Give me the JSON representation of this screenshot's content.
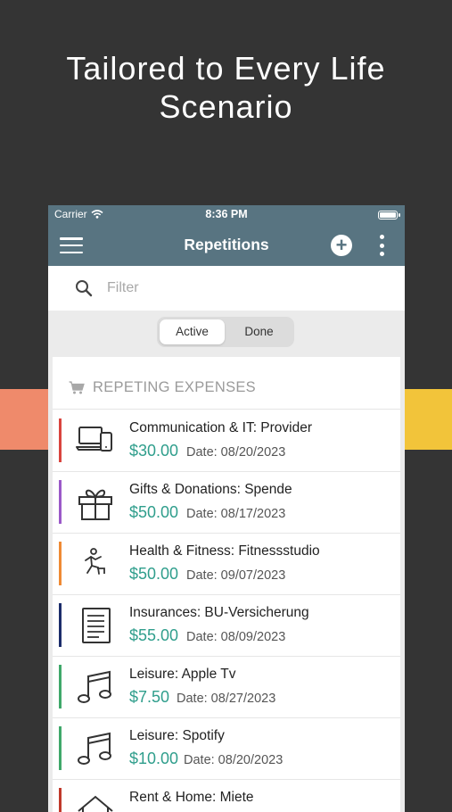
{
  "headline": {
    "line1": "Tailored to Every Life",
    "line2": "Scenario"
  },
  "status": {
    "carrier": "Carrier",
    "time": "8:36 PM"
  },
  "appbar": {
    "title": "Repetitions",
    "add_icon": "plus-circle-icon",
    "more_icon": "more-vertical-icon",
    "menu_icon": "hamburger-icon"
  },
  "search": {
    "placeholder": "Filter",
    "value": ""
  },
  "segments": {
    "active": "Active",
    "done": "Done",
    "selected": "Active"
  },
  "section": {
    "label": "REPETING EXPENSES",
    "icon": "cart-icon"
  },
  "colors": {
    "header": "#587481",
    "amount": "#2f9e8c",
    "left_band": "#ef8a6b",
    "right_band": "#f2c43a"
  },
  "expenses": [
    {
      "title": "Communication & IT: Provider",
      "amount": "$30.00",
      "date": "Date: 08/20/2023",
      "color": "#d9443e",
      "icon": "devices-icon"
    },
    {
      "title": "Gifts & Donations: Spende",
      "amount": "$50.00",
      "date": "Date: 08/17/2023",
      "color": "#9b59c8",
      "icon": "gift-icon"
    },
    {
      "title": "Health & Fitness: Fitnessstudio",
      "amount": "$50.00",
      "date": "Date: 09/07/2023",
      "color": "#ef8a34",
      "icon": "fitness-icon"
    },
    {
      "title": "Insurances: BU-Versicherung",
      "amount": "$55.00",
      "date": "Date: 08/09/2023",
      "color": "#1c2d6b",
      "icon": "document-icon"
    },
    {
      "title": "Leisure: Apple Tv",
      "amount": "$7.50",
      "date": "Date: 08/27/2023",
      "color": "#3fa86a",
      "icon": "music-note-icon"
    },
    {
      "title": "Leisure: Spotify",
      "amount": "$10.00",
      "date": "Date: 08/20/2023",
      "color": "#3fa86a",
      "icon": "music-note-icon"
    },
    {
      "title": "Rent & Home: Miete",
      "amount": "",
      "date": "",
      "color": "#c0392b",
      "icon": "house-icon"
    }
  ]
}
